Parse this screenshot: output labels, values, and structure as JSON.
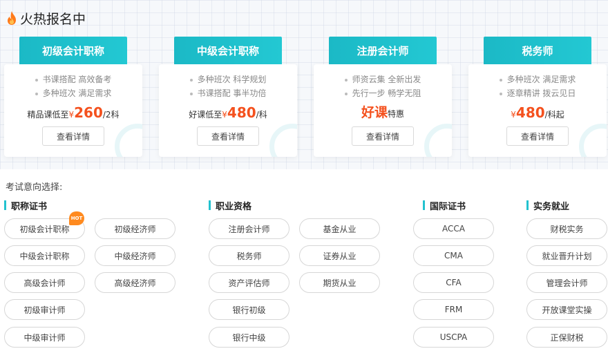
{
  "hot": {
    "title": "火热报名中",
    "cards": [
      {
        "name": "初级会计职称",
        "features": [
          "书课搭配 高效备考",
          "多种班次 满足需求"
        ],
        "price_prefix": "精品课低至",
        "currency": "¥",
        "price": "260",
        "price_suffix": "/2科",
        "button": "查看详情"
      },
      {
        "name": "中级会计职称",
        "features": [
          "多种班次 科学规划",
          "书课搭配 事半功倍"
        ],
        "price_prefix": "好课低至",
        "currency": "¥",
        "price": "480",
        "price_suffix": "/科",
        "button": "查看详情"
      },
      {
        "name": "注册会计师",
        "features": [
          "师资云集 全新出发",
          "先行一步 畅学无阻"
        ],
        "highlight": "好课",
        "highlight_suffix": "特惠",
        "button": "查看详情"
      },
      {
        "name": "税务师",
        "features": [
          "多种班次 满足需求",
          "逐章精讲 拨云见日"
        ],
        "currency": "¥",
        "price": "480",
        "price_suffix": "/科起",
        "button": "查看详情"
      }
    ]
  },
  "select_label": "考试意向选择:",
  "groups": [
    {
      "title": "职称证书",
      "col1": [
        "初级会计职称",
        "中级会计职称",
        "高级会计师",
        "初级审计师",
        "中级审计师"
      ],
      "col2": [
        "初级经济师",
        "中级经济师",
        "高级经济师"
      ]
    },
    {
      "title": "职业资格",
      "col1": [
        "注册会计师",
        "税务师",
        "资产评估师",
        "银行初级",
        "银行中级"
      ],
      "col2": [
        "基金从业",
        "证券从业",
        "期货从业"
      ]
    },
    {
      "title": "国际证书",
      "col1": [
        "ACCA",
        "CMA",
        "CFA",
        "FRM",
        "USCPA"
      ]
    },
    {
      "title": "实务就业",
      "col1": [
        "财税实务",
        "就业晋升计划",
        "管理会计师",
        "开放课堂实操",
        "正保财税"
      ]
    }
  ],
  "badge": "HOT",
  "colors": {
    "accent": "#23c2cf",
    "price": "#f4511e",
    "hot_badge": "#ff8a1f"
  }
}
